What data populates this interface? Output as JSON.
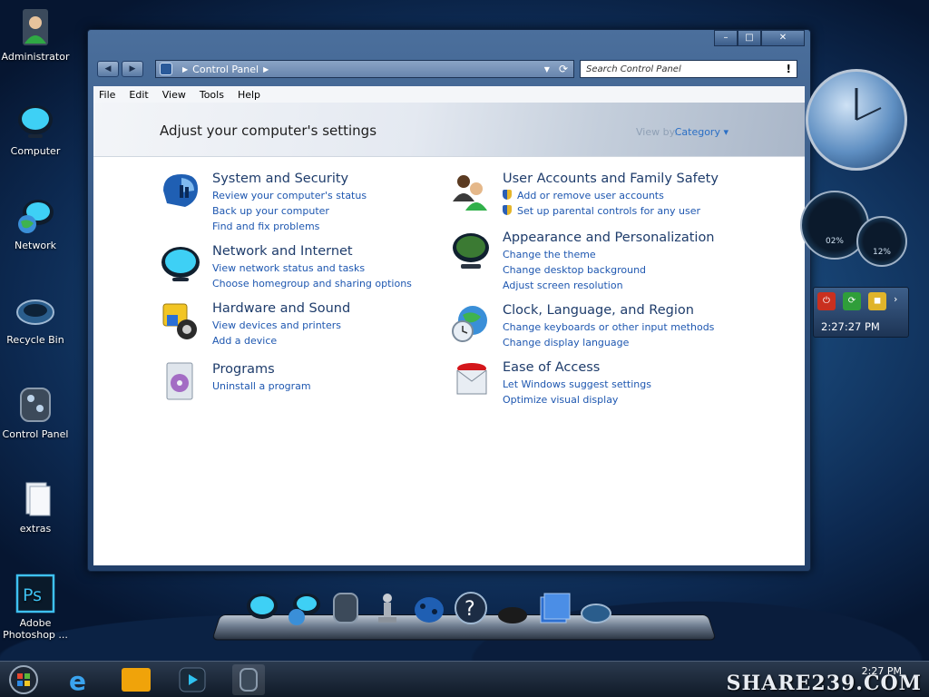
{
  "desktop": {
    "icons": [
      {
        "label": "Administrator"
      },
      {
        "label": "Computer"
      },
      {
        "label": "Network"
      },
      {
        "label": "Recycle Bin"
      },
      {
        "label": "Control Panel"
      },
      {
        "label": "extras"
      },
      {
        "label": "Adobe Photoshop ..."
      }
    ]
  },
  "window": {
    "address": {
      "crumb": "Control Panel"
    },
    "search": {
      "placeholder": "Search Control Panel"
    },
    "menu": [
      "File",
      "Edit",
      "View",
      "Tools",
      "Help"
    ],
    "heading": "Adjust your computer's settings",
    "view_by_label": "View by:",
    "view_by_value": "Category",
    "categories": [
      {
        "title": "System and Security",
        "links": [
          "Review your computer's status",
          "Back up your computer",
          "Find and fix problems"
        ]
      },
      {
        "title": "Network and Internet",
        "links": [
          "View network status and tasks",
          "Choose homegroup and sharing options"
        ]
      },
      {
        "title": "Hardware and Sound",
        "links": [
          "View devices and printers",
          "Add a device"
        ]
      },
      {
        "title": "Programs",
        "links": [
          "Uninstall a program"
        ]
      },
      {
        "title": "User Accounts and Family Safety",
        "links": [
          "Add or remove user accounts",
          "Set up parental controls for any user"
        ]
      },
      {
        "title": "Appearance and Personalization",
        "links": [
          "Change the theme",
          "Change desktop background",
          "Adjust screen resolution"
        ]
      },
      {
        "title": "Clock, Language, and Region",
        "links": [
          "Change keyboards or other input methods",
          "Change display language"
        ]
      },
      {
        "title": "Ease of Access",
        "links": [
          "Let Windows suggest settings",
          "Optimize visual display"
        ]
      }
    ]
  },
  "gadgets": {
    "meter1_value": "02%",
    "meter2_value": "12%",
    "clock_time": "2:27:27 PM"
  },
  "taskbar": {
    "time": "2:27 PM"
  },
  "watermark": "SHARE239.COM"
}
